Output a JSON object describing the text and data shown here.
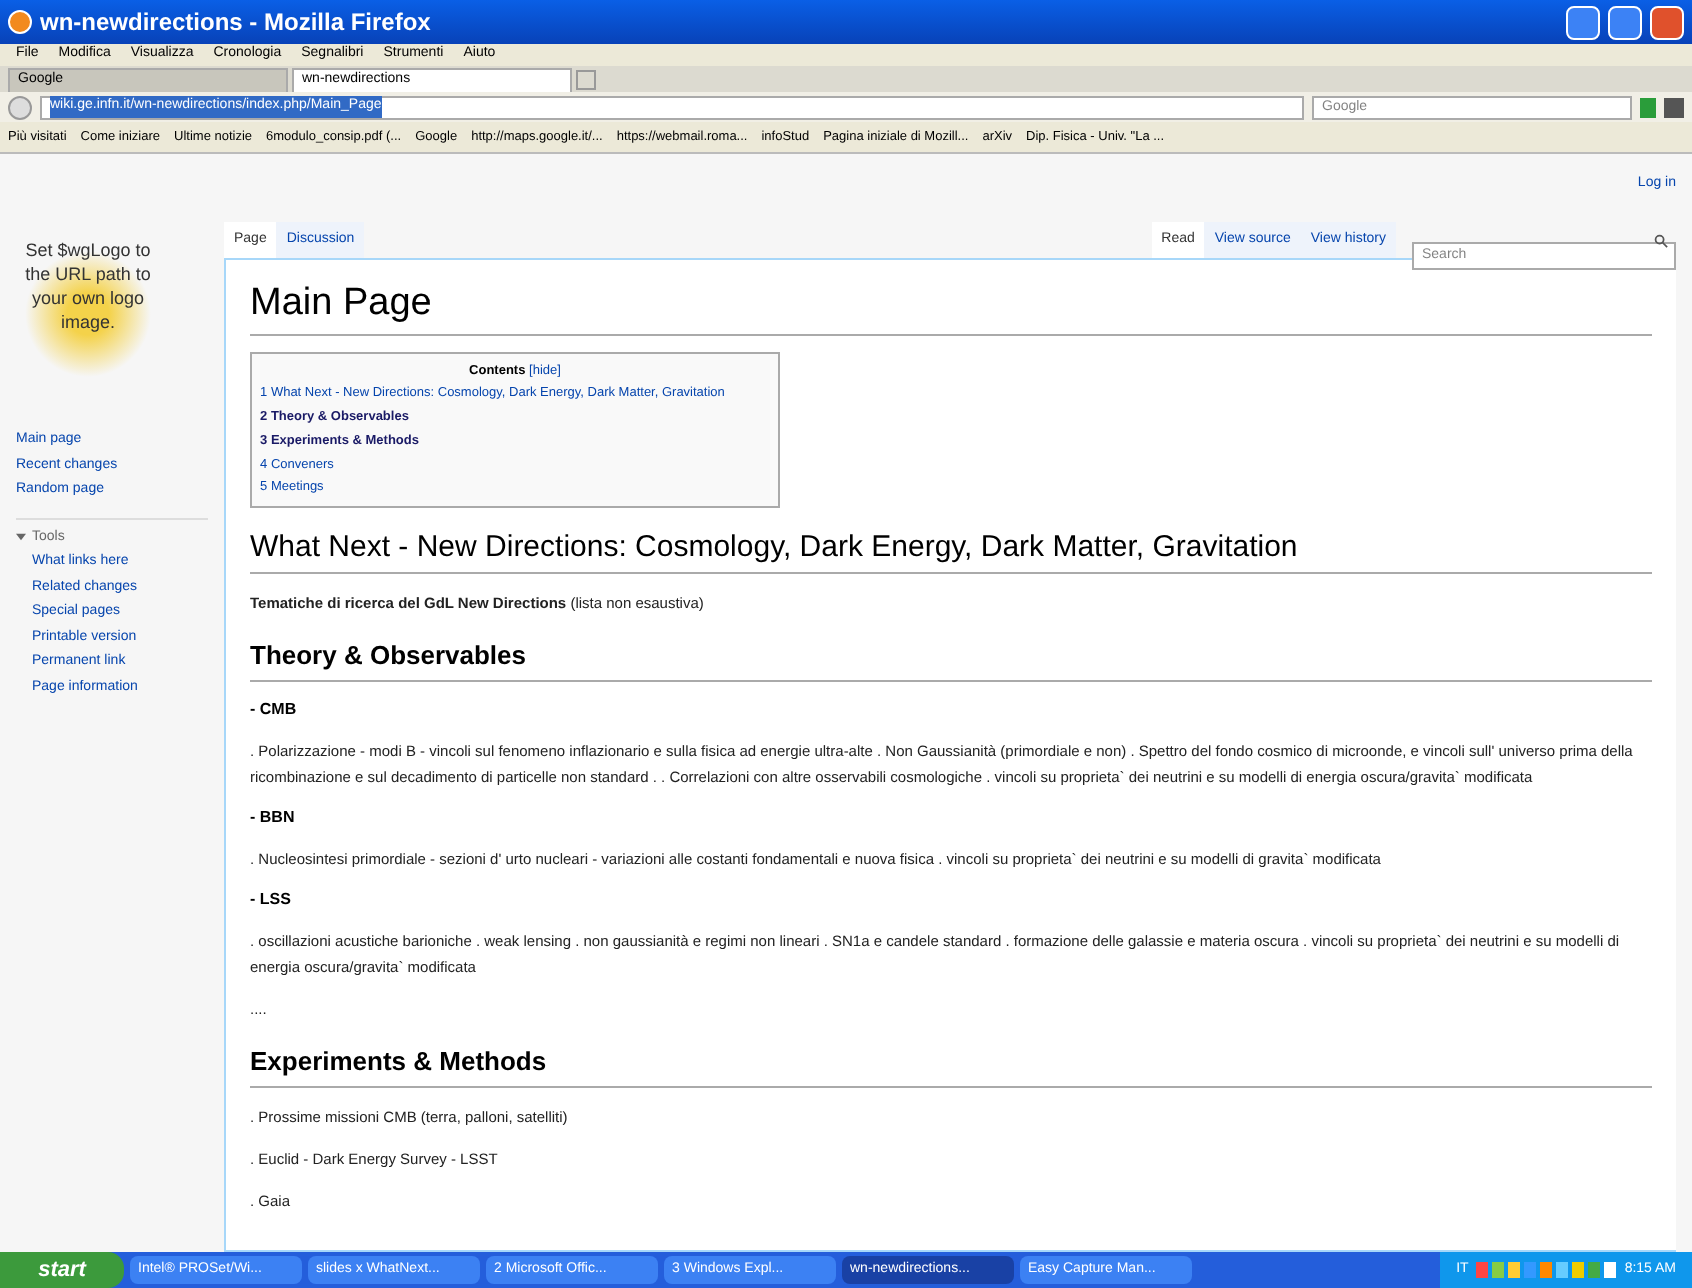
{
  "window": {
    "title": "wn-newdirections - Mozilla Firefox"
  },
  "menu": [
    "File",
    "Modifica",
    "Visualizza",
    "Cronologia",
    "Segnalibri",
    "Strumenti",
    "Aiuto"
  ],
  "tabs": [
    {
      "label": "Google",
      "selected": false
    },
    {
      "label": "wn-newdirections",
      "selected": true
    }
  ],
  "url": "wiki.ge.infn.it/wn-newdirections/index.php/Main_Page",
  "web_search": {
    "placeholder": "Google"
  },
  "bookmarks": [
    "Più visitati",
    "Come iniziare",
    "Ultime notizie",
    "6modulo_consip.pdf (...",
    "Google",
    "http://maps.google.it/...",
    "https://webmail.roma...",
    "infoStud",
    "Pagina iniziale di Mozill...",
    "arXiv",
    "Dip. Fisica - Univ. \"La ..."
  ],
  "logo_text": "Set $wgLogo to the URL path to your own logo image.",
  "login": "Log in",
  "nav": [
    "Main page",
    "Recent changes",
    "Random page"
  ],
  "tools": {
    "label": "Tools",
    "expanded": true,
    "items": [
      "What links here",
      "Related changes",
      "Special pages",
      "Printable version",
      "Permanent link",
      "Page information"
    ]
  },
  "page_tabs": [
    {
      "label": "Page",
      "selected": true
    },
    {
      "label": "Discussion",
      "selected": false
    }
  ],
  "view_tabs": [
    {
      "label": "Read",
      "selected": true
    },
    {
      "label": "View source",
      "selected": false
    },
    {
      "label": "View history",
      "selected": false
    }
  ],
  "search": {
    "placeholder": "Search"
  },
  "title": "Main Page",
  "toc": {
    "title": "Contents",
    "toggle": "[hide]",
    "items": [
      {
        "number": "1",
        "text": "What Next - New Directions: Cosmology, Dark Energy, Dark Matter, Gravitation",
        "visited": false
      },
      {
        "number": "2",
        "text": "Theory & Observables",
        "visited": true
      },
      {
        "number": "3",
        "text": "Experiments & Methods",
        "visited": true
      },
      {
        "number": "4",
        "text": "Conveners",
        "visited": false
      },
      {
        "number": "5",
        "text": "Meetings",
        "visited": false
      }
    ]
  },
  "content": [
    {
      "kind": "h1",
      "text": "What Next - New Directions: Cosmology, Dark Energy, Dark Matter, Gravitation"
    },
    {
      "kind": "para",
      "text": "**Tematiche di ricerca del GdL New Directions** (lista non esaustiva)"
    },
    {
      "kind": "h2",
      "text": "Theory & Observables"
    },
    {
      "kind": "label",
      "text": "- CMB"
    },
    {
      "kind": "para",
      "text": ". Polarizzazione - modi B - vincoli sul fenomeno inflazionario e sulla fisica ad energie ultra-alte . Non Gaussianità (primordiale e non) . Spettro del fondo cosmico di microonde, e vincoli sull' universo prima della ricombinazione e sul decadimento di particelle non standard . . Correlazioni con altre osservabili cosmologiche . vincoli su proprieta` dei neutrini e su modelli di energia oscura/gravita` modificata"
    },
    {
      "kind": "label",
      "text": "- BBN"
    },
    {
      "kind": "para",
      "text": ". Nucleosintesi primordiale - sezioni d' urto nucleari - variazioni alle costanti fondamentali e nuova fisica . vincoli su proprieta` dei neutrini e su modelli di gravita` modificata"
    },
    {
      "kind": "label",
      "text": "- LSS"
    },
    {
      "kind": "para",
      "text": ". oscillazioni acustiche barioniche . weak lensing . non gaussianità e regimi non lineari . SN1a e candele standard . formazione delle galassie e materia oscura . vincoli su proprieta` dei neutrini e su modelli di energia oscura/gravita` modificata"
    },
    {
      "kind": "para",
      "text": "...."
    },
    {
      "kind": "h2",
      "text": "Experiments & Methods"
    },
    {
      "kind": "para",
      "text": ". Prossime missioni CMB (terra, palloni, satelliti)"
    },
    {
      "kind": "para",
      "text": ". Euclid - Dark Energy Survey - LSST"
    },
    {
      "kind": "para",
      "text": ". Gaia"
    }
  ],
  "taskbar": {
    "start": "start",
    "items": [
      {
        "label": "Intel® PROSet/Wi...",
        "selected": false
      },
      {
        "label": "slides x WhatNext...",
        "selected": false
      },
      {
        "label": "2 Microsoft Offic...",
        "selected": false
      },
      {
        "label": "3 Windows Expl...",
        "selected": false
      },
      {
        "label": "wn-newdirections...",
        "selected": true
      },
      {
        "label": "Easy Capture Man...",
        "selected": false
      }
    ],
    "language": "IT",
    "clock": "8:15 AM"
  }
}
